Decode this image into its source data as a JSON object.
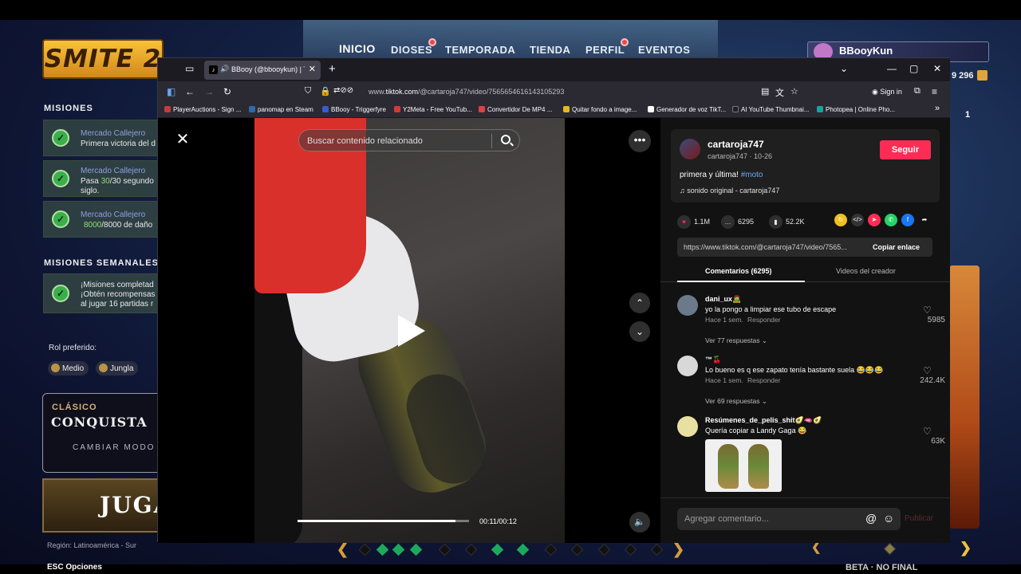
{
  "game": {
    "logo": "SMITE 2",
    "nav": [
      "INICIO",
      "DIOSES",
      "TEMPORADA",
      "TIENDA",
      "PERFIL",
      "EVENTOS"
    ],
    "user": "BBooyKun",
    "coins": "9 296",
    "counter": "1",
    "missions_title": "MISIONES",
    "missions": [
      {
        "title": "Mercado Callejero",
        "desc": "Primera victoria del d"
      },
      {
        "title": "Mercado Callejero",
        "desc_a": "Pasa ",
        "desc_num": "30",
        "desc_b": "/30 segundo",
        "desc2": "siglo."
      },
      {
        "title": "Mercado Callejero",
        "desc_num": "8000",
        "desc_b": "/8000 de daño"
      }
    ],
    "weekly_title": "MISIONES SEMANALES",
    "weekly": {
      "line1": "¡Misiones completad",
      "line2": "¡Obtén recompensas",
      "line3": "al jugar 16 partidas r"
    },
    "role_label": "Rol preferido:",
    "roles": [
      "Medio",
      "Jungla"
    ],
    "mode_kicker": "CLÁSICO",
    "mode_name": "CONQUISTA",
    "mode_change": "CAMBIAR MODO",
    "play": "JUGA",
    "region": "Región: Latinoamérica - Sur",
    "esc": "ESC  Opciones",
    "beta": "BETA · NO FINAL"
  },
  "browser": {
    "tab_title": "BBooy (@bbooykun) | TikTo",
    "url_prefix": "www.",
    "url_domain": "tiktok.com",
    "url_path": "/@cartaroja747/video/7565654616143105293",
    "signin": "Sign in",
    "bookmarks": [
      {
        "label": "PlayerAuctions - Sign ...",
        "color": "#c43a3a"
      },
      {
        "label": "panomap en Steam",
        "color": "#2d6aa8"
      },
      {
        "label": "BBooy - Triggerfyre",
        "color": "#3a5ad0"
      },
      {
        "label": "Y2Meta - Free YouTub...",
        "color": "#d23a3a"
      },
      {
        "label": "Convertidor De MP4 ...",
        "color": "#e04040"
      },
      {
        "label": "Quitar fondo a image...",
        "color": "#e8b81c"
      },
      {
        "label": "Generador de voz TikT...",
        "color": "#ffffff"
      },
      {
        "label": "AI YouTube Thumbnai...",
        "color": "#202020"
      },
      {
        "label": "Photopea | Online Pho...",
        "color": "#18a3a3"
      }
    ]
  },
  "video": {
    "search_placeholder": "Buscar contenido relacionado",
    "time": "00:11/00:12",
    "progress": 0.92
  },
  "post": {
    "author": "cartaroja747",
    "author_sub": "cartaroja747 · 10-26",
    "follow": "Seguir",
    "caption": "primera y última! ",
    "hashtag": "#moto",
    "sound": "♫  sonido original - cartaroja747",
    "likes": "1.1M",
    "comments": "6295",
    "saves": "52.2K",
    "link": "https://www.tiktok.com/@cartaroja747/video/7565...",
    "copy": "Copiar enlace",
    "tab_comments": "Comentarios (6295)",
    "tab_creator": "Videos del creador",
    "comment_list": [
      {
        "user": "dani_ux🧟",
        "text": "yo la pongo a limpiar ese tubo de escape",
        "meta": "Hace 1 sem.",
        "reply": "Responder",
        "likes": "5985",
        "more": "Ver 77 respuestas ⌄"
      },
      {
        "user": "™🍒",
        "text": "Lo bueno es q ese zapato tenía bastante suela 😂😂😂",
        "meta": "Hace 1 sem.",
        "reply": "Responder",
        "likes": "242.4K",
        "more": "Ver 69 respuestas ⌄"
      },
      {
        "user": "Resúmenes_de_pelis_shit🥑🫦🥑",
        "text": "Quería copiar a Landy Gaga 😂",
        "likes": "63K"
      }
    ],
    "add_placeholder": "Agregar comentario...",
    "publish": "Publicar"
  }
}
